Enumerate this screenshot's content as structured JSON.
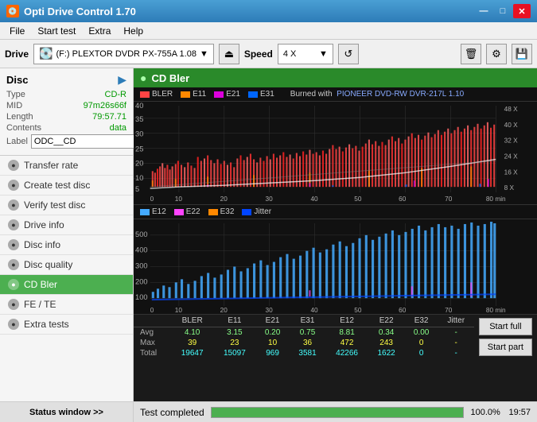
{
  "titleBar": {
    "icon": "💿",
    "title": "Opti Drive Control 1.70",
    "minimize": "—",
    "maximize": "□",
    "close": "✕"
  },
  "menuBar": {
    "items": [
      "File",
      "Start test",
      "Extra",
      "Help"
    ]
  },
  "toolbar": {
    "driveLabel": "Drive",
    "driveIcon": "💽",
    "driveName": "(F:)  PLEXTOR DVDR  PX-755A 1.08",
    "speedLabel": "Speed",
    "speedValue": "4 X",
    "ejectIcon": "⏏",
    "refreshIcon": "↺",
    "eraseIcon": "🗑",
    "settingsIcon": "⚙",
    "saveIcon": "💾"
  },
  "disc": {
    "title": "Disc",
    "type": "CD-R",
    "mid": "97m26s66f",
    "length": "79:57.71",
    "contents": "data",
    "label": "ODC__CD"
  },
  "sidebar": {
    "items": [
      {
        "id": "transfer-rate",
        "label": "Transfer rate",
        "active": false
      },
      {
        "id": "create-test-disc",
        "label": "Create test disc",
        "active": false
      },
      {
        "id": "verify-test-disc",
        "label": "Verify test disc",
        "active": false
      },
      {
        "id": "drive-info",
        "label": "Drive info",
        "active": false
      },
      {
        "id": "disc-info",
        "label": "Disc info",
        "active": false
      },
      {
        "id": "disc-quality",
        "label": "Disc quality",
        "active": false
      },
      {
        "id": "cd-bler",
        "label": "CD Bler",
        "active": true
      },
      {
        "id": "fe-te",
        "label": "FE / TE",
        "active": false
      },
      {
        "id": "extra-tests",
        "label": "Extra tests",
        "active": false
      }
    ],
    "statusWindow": "Status window >>"
  },
  "chart": {
    "title": "CD Bler",
    "icon": "●",
    "legend1": [
      {
        "label": "BLER",
        "color": "#ff4444"
      },
      {
        "label": "E11",
        "color": "#ff8800"
      },
      {
        "label": "E21",
        "color": "#dd00dd"
      },
      {
        "label": "E31",
        "color": "#0066ff"
      }
    ],
    "burnedWith": "Burned with",
    "burnerName": "PIONEER DVD-RW DVR-217L 1.10",
    "legend2": [
      {
        "label": "E12",
        "color": "#44aaff"
      },
      {
        "label": "E22",
        "color": "#ff44ff"
      },
      {
        "label": "E32",
        "color": "#ff8800"
      },
      {
        "label": "Jitter",
        "color": "#0044ff"
      }
    ],
    "yAxis1Max": 40,
    "yAxis2Right": [
      "48 X",
      "40 X",
      "32 X",
      "24 X",
      "16 X",
      "8 X"
    ],
    "xAxisLabels": [
      "0",
      "10",
      "20",
      "30",
      "40",
      "50",
      "60",
      "70",
      "80 min"
    ]
  },
  "dataTable": {
    "headers": [
      "",
      "BLER",
      "E11",
      "E21",
      "E31",
      "E12",
      "E22",
      "E32",
      "Jitter",
      ""
    ],
    "rows": [
      {
        "label": "Avg",
        "values": [
          "4.10",
          "3.15",
          "0.20",
          "0.75",
          "8.81",
          "0.34",
          "0.00",
          "-"
        ],
        "color": "green"
      },
      {
        "label": "Max",
        "values": [
          "39",
          "23",
          "10",
          "36",
          "472",
          "243",
          "0",
          "-"
        ],
        "color": "yellow"
      },
      {
        "label": "Total",
        "values": [
          "19647",
          "15097",
          "969",
          "3581",
          "42266",
          "1622",
          "0",
          "-"
        ],
        "color": "cyan"
      }
    ],
    "buttons": {
      "startFull": "Start full",
      "startPart": "Start part"
    }
  },
  "statusBar": {
    "statusWindow": "Status window >>",
    "statusText": "Test completed",
    "progressPct": "100.0%",
    "progressValue": 100,
    "time": "19:57"
  }
}
